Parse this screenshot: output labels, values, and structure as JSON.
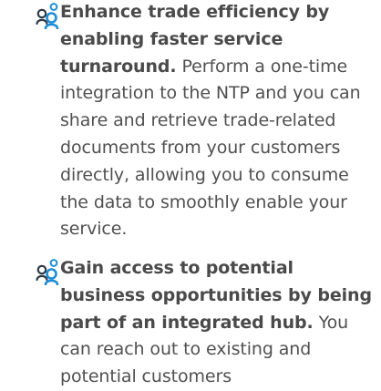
{
  "items": [
    {
      "icon": "people-connection-icon",
      "headline": "Enhance trade efficiency by enabling faster service turnaround.",
      "body": " Perform a one-time integration to the NTP and you can share and retrieve trade-related documents from your customers directly, allowing you to consume the data to smoothly enable your service."
    },
    {
      "icon": "people-connection-icon",
      "headline": "Gain access to potential business opportunities by being part of an integrated hub.",
      "body": " You can reach out to existing and potential customers"
    }
  ],
  "colors": {
    "text": "#505050",
    "icon_dark": "#2e3a44",
    "icon_blue": "#1e8fd6"
  }
}
